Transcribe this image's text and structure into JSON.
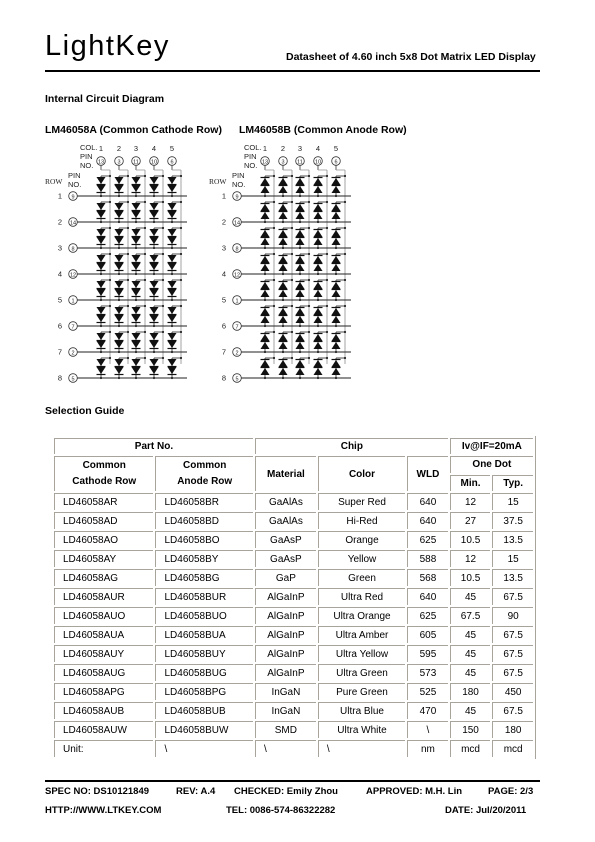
{
  "header": {
    "logo": "LightKey",
    "title": "Datasheet of 4.60 inch 5x8 Dot Matrix LED Display"
  },
  "circuit": {
    "heading": "Internal Circuit Diagram",
    "diagrams": [
      {
        "title": "LM46058A (Common Cathode Row)",
        "type": "cathode"
      },
      {
        "title": "LM46058B (Common Anode Row)",
        "type": "anode"
      }
    ],
    "col_label": "COL.",
    "pin_label": "PIN",
    "no_label": "NO.",
    "row_label": "ROW",
    "columns": [
      "1",
      "2",
      "3",
      "4",
      "5"
    ],
    "column_pins": [
      "13",
      "3",
      "11",
      "10",
      "6"
    ],
    "rows": [
      "1",
      "2",
      "3",
      "4",
      "5",
      "6",
      "7",
      "8"
    ],
    "row_pins": [
      "9",
      "14",
      "8",
      "12",
      "1",
      "7",
      "2",
      "5"
    ]
  },
  "selection": {
    "heading": "Selection Guide",
    "headers": {
      "part_no": "Part No.",
      "chip": "Chip",
      "iv": "Iv@IF=20mA",
      "common_cathode": [
        "Common",
        "Cathode Row"
      ],
      "common_anode": [
        "Common",
        "Anode Row"
      ],
      "material": "Material",
      "color": "Color",
      "wld": "WLD",
      "one_dot": "One Dot",
      "min": "Min.",
      "typ": "Typ."
    },
    "rows": [
      [
        "LD46058AR",
        "LD46058BR",
        "GaAlAs",
        "Super Red",
        "640",
        "12",
        "15"
      ],
      [
        "LD46058AD",
        "LD46058BD",
        "GaAlAs",
        "Hi-Red",
        "640",
        "27",
        "37.5"
      ],
      [
        "LD46058AO",
        "LD46058BO",
        "GaAsP",
        "Orange",
        "625",
        "10.5",
        "13.5"
      ],
      [
        "LD46058AY",
        "LD46058BY",
        "GaAsP",
        "Yellow",
        "588",
        "12",
        "15"
      ],
      [
        "LD46058AG",
        "LD46058BG",
        "GaP",
        "Green",
        "568",
        "10.5",
        "13.5"
      ],
      [
        "LD46058AUR",
        "LD46058BUR",
        "AlGaInP",
        "Ultra Red",
        "640",
        "45",
        "67.5"
      ],
      [
        "LD46058AUO",
        "LD46058BUO",
        "AlGaInP",
        "Ultra Orange",
        "625",
        "67.5",
        "90"
      ],
      [
        "LD46058AUA",
        "LD46058BUA",
        "AlGaInP",
        "Ultra Amber",
        "605",
        "45",
        "67.5"
      ],
      [
        "LD46058AUY",
        "LD46058BUY",
        "AlGaInP",
        "Ultra Yellow",
        "595",
        "45",
        "67.5"
      ],
      [
        "LD46058AUG",
        "LD46058BUG",
        "AlGaInP",
        "Ultra Green",
        "573",
        "45",
        "67.5"
      ],
      [
        "LD46058APG",
        "LD46058BPG",
        "InGaN",
        "Pure Green",
        "525",
        "180",
        "450"
      ],
      [
        "LD46058AUB",
        "LD46058BUB",
        "InGaN",
        "Ultra Blue",
        "470",
        "45",
        "67.5"
      ],
      [
        "LD46058AUW",
        "LD46058BUW",
        "SMD",
        "Ultra White",
        "\\",
        "150",
        "180"
      ]
    ],
    "unit_row": [
      "Unit:",
      "\\",
      "\\",
      "\\",
      "nm",
      "mcd",
      "mcd"
    ]
  },
  "footer": {
    "spec_no": "SPEC NO: DS10121849",
    "rev": "REV: A.4",
    "checked": "CHECKED: Emily Zhou",
    "approved": "APPROVED: M.H. Lin",
    "page": "PAGE: 2/3",
    "website": "HTTP://WWW.LTKEY.COM",
    "tel": "TEL: 0086-574-86322282",
    "date": "DATE: Jul/20/2011"
  }
}
